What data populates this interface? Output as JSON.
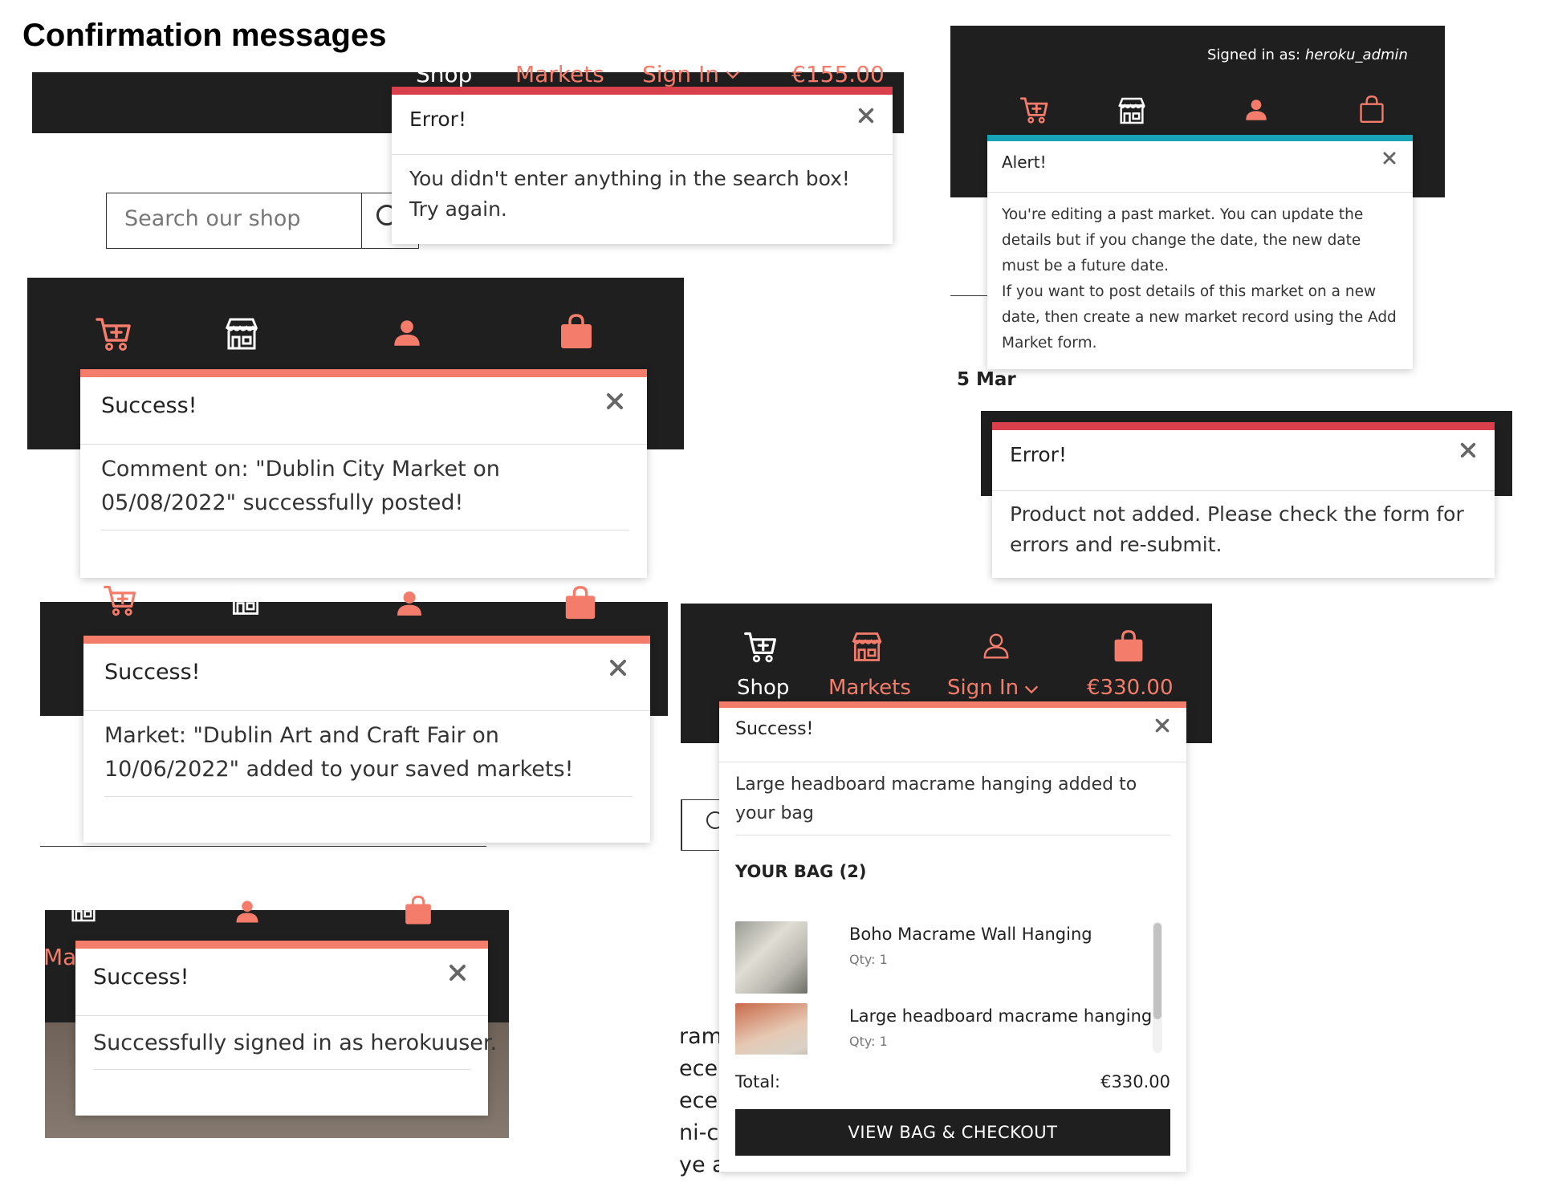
{
  "page_title": "Confirmation messages",
  "colors": {
    "nav_bg": "#1f1f1f",
    "accent": "#f47c6b",
    "error": "#d9404b",
    "info": "#17a2b8",
    "checkout": "#1f1f1f"
  },
  "panel_top_left": {
    "nav": {
      "shop": "Shop",
      "markets": "Markets",
      "sign_in": "Sign In",
      "total": "€155.00"
    },
    "search_placeholder": "Search our shop",
    "toast": {
      "title": "Error!",
      "message": "You didn't enter anything in the search box! Try again."
    }
  },
  "panel_top_right": {
    "signed_in_label": "Signed in as:",
    "signed_in_user": "heroku_admin",
    "toast": {
      "title": "Alert!",
      "message_1": "You're editing a past market. You can update the details but if you change the date, the new date must be a future date.",
      "message_2": "If you want to post details of this market on a new date, then create a new market record using the Add Market form."
    },
    "date_fragment": "5 Mar"
  },
  "panel_comment": {
    "toast": {
      "title": "Success!",
      "message": "Comment on: \"Dublin City Market on 05/08/2022\" successfully posted!"
    }
  },
  "panel_product_error": {
    "toast": {
      "title": "Error!",
      "message": "Product not added. Please check the form for errors and re-submit."
    }
  },
  "panel_market_saved": {
    "toast": {
      "title": "Success!",
      "message": "Market: \"Dublin Art and Craft Fair on 10/06/2022\" added to your saved markets!"
    }
  },
  "panel_signin": {
    "nav_fragment": "Ma",
    "toast": {
      "title": "Success!",
      "message": "Successfully signed in as herokuuser."
    }
  },
  "panel_bag": {
    "nav": {
      "shop": "Shop",
      "markets": "Markets",
      "sign_in": "Sign In",
      "total": "€330.00"
    },
    "toast": {
      "title": "Success!",
      "message": "Large headboard macrame hanging added to your bag",
      "bag_heading": "YOUR BAG (2)",
      "items": [
        {
          "name": "Boho Macrame Wall Hanging",
          "qty": "Qty: 1"
        },
        {
          "name": "Large headboard macrame hanging",
          "qty": "Qty: 1"
        }
      ],
      "total_label": "Total:",
      "total_value": "€330.00",
      "checkout_label": "VIEW BAG & CHECKOUT"
    },
    "background_text": [
      "ram",
      "ece",
      "ece",
      "ni-ci",
      "ye a"
    ]
  },
  "icons": [
    "cart-plus-icon",
    "store-icon",
    "user-icon",
    "bag-icon",
    "close-icon",
    "chevron-down-icon",
    "search-icon"
  ]
}
